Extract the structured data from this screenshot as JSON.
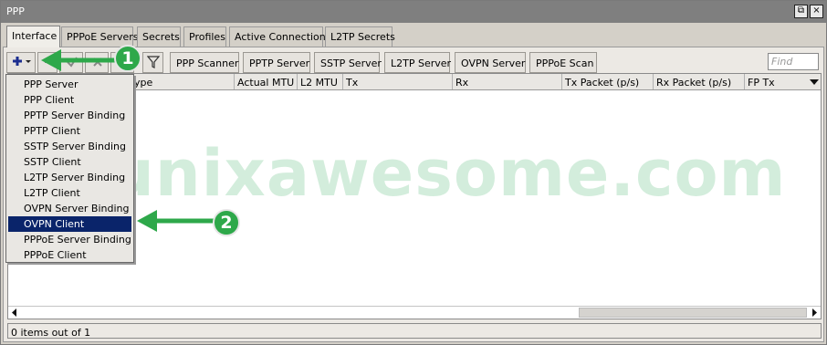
{
  "window": {
    "title": "PPP",
    "restore_glyph": "⧉",
    "close_glyph": "×"
  },
  "tabs": [
    "Interface",
    "PPPoE Servers",
    "Secrets",
    "Profiles",
    "Active Connections",
    "L2TP Secrets"
  ],
  "toolbar": {
    "buttons": [
      "PPP Scanner",
      "PPTP Server",
      "SSTP Server",
      "L2TP Server",
      "OVPN Server",
      "PPPoE Scan"
    ],
    "find_placeholder": "Find"
  },
  "columns": [
    "Type",
    "Actual MTU",
    "L2 MTU",
    "Tx",
    "Rx",
    "Tx Packet (p/s)",
    "Rx Packet (p/s)",
    "FP Tx"
  ],
  "add_menu": {
    "items": [
      "PPP Server",
      "PPP Client",
      "PPTP Server Binding",
      "PPTP Client",
      "SSTP Server Binding",
      "SSTP Client",
      "L2TP Server Binding",
      "L2TP Client",
      "OVPN Server Binding",
      "OVPN Client",
      "PPPoE Server Binding",
      "PPPoE Client"
    ],
    "selected": "OVPN Client"
  },
  "status": "0 items out of 1",
  "watermark": "unixawesome.com",
  "annotations": {
    "step1": "1",
    "step2": "2",
    "arrow_color": "#2ea84a"
  }
}
